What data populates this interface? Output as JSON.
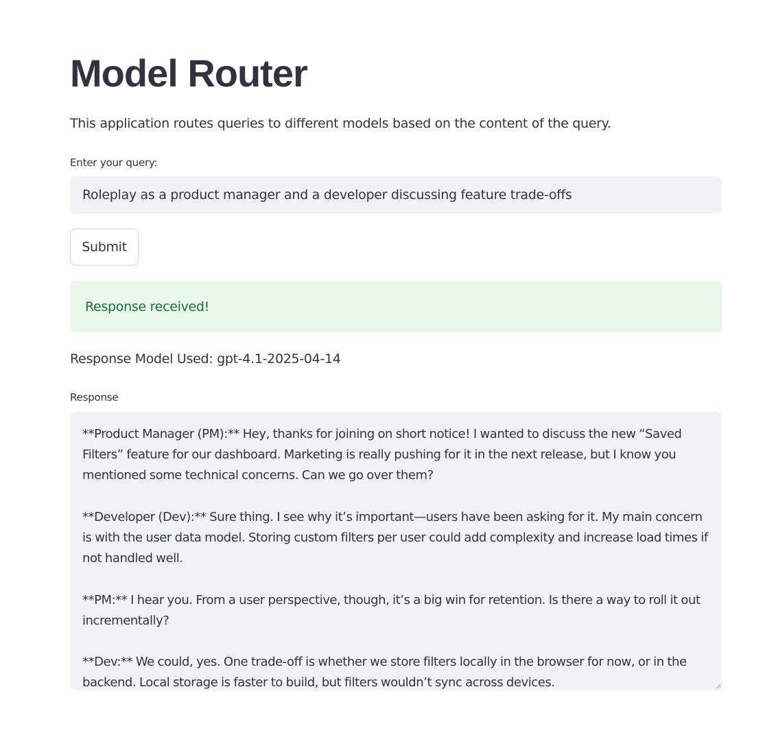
{
  "page": {
    "title": "Model Router",
    "description": "This application routes queries to different models based on the content of the query."
  },
  "query": {
    "label": "Enter your query:",
    "value": "Roleplay as a product manager and a developer discussing feature trade-offs"
  },
  "submit": {
    "label": "Submit"
  },
  "alert": {
    "message": "Response received!",
    "color": "#177233",
    "background": "#e8f6ec"
  },
  "model": {
    "text": "Response Model Used: gpt-4.1-2025-04-14"
  },
  "response": {
    "label": "Response",
    "text": "**Product Manager (PM):** Hey, thanks for joining on short notice! I wanted to discuss the new “Saved Filters” feature for our dashboard. Marketing is really pushing for it in the next release, but I know you mentioned some technical concerns. Can we go over them?\n\n**Developer (Dev):** Sure thing. I see why it’s important—users have been asking for it. My main concern is with the user data model. Storing custom filters per user could add complexity and increase load times if not handled well.\n\n**PM:** I hear you. From a user perspective, though, it’s a big win for retention. Is there a way to roll it out incrementally?\n\n**Dev:** We could, yes. One trade-off is whether we store filters locally in the browser for now, or in the backend. Local storage is faster to build, but filters wouldn’t sync across devices."
  },
  "icons": {
    "resize": "resize-grip-icon"
  }
}
